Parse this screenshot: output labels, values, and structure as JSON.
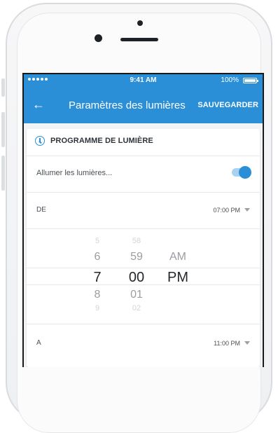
{
  "status": {
    "time": "9:41 AM",
    "battery": "100%"
  },
  "header": {
    "back_glyph": "←",
    "title": "Paramètres des lumières",
    "save_label": "SAUVEGARDER"
  },
  "card": {
    "title": "PROGRAMME DE LUMIÈRE",
    "light_label": "Allumer les lumières...",
    "light_on": true,
    "from_label": "DE",
    "from_value": "07:00 PM",
    "to_label": "A",
    "to_value": "11:00 PM"
  },
  "picker": {
    "hours": [
      "5",
      "6",
      "7",
      "8",
      "9"
    ],
    "minutes": [
      "58",
      "59",
      "00",
      "01",
      "02"
    ],
    "period": [
      "AM",
      "PM"
    ],
    "selected": {
      "hour": "7",
      "minute": "00",
      "period": "PM"
    }
  },
  "colors": {
    "accent": "#2b8fd7",
    "toggle_track": "#a9d1f0"
  }
}
